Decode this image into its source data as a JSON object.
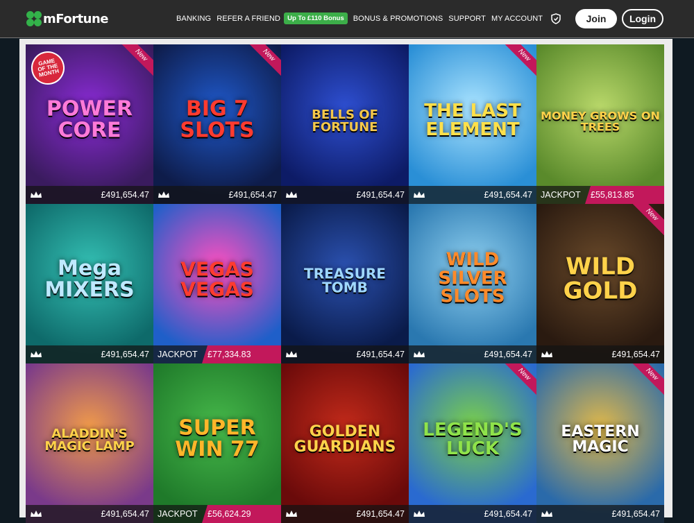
{
  "header": {
    "logo_text": "mFortune",
    "nav": [
      "BANKING",
      "REFER A FRIEND",
      "BONUS & PROMOTIONS",
      "SUPPORT",
      "MY ACCOUNT"
    ],
    "bonus_badge": "Up To £110 Bonus",
    "join_label": "Join",
    "login_label": "Login"
  },
  "labels": {
    "new": "New",
    "jackpot": "JACKPOT",
    "gotm": "GAME OF THE MONTH"
  },
  "colors": {
    "accent_pink": "#c2185b",
    "badge_green": "#3cae49",
    "topbar": "#2b2b2b"
  },
  "games": [
    {
      "name": "POWER CORE",
      "amount": "£491,654.47",
      "new": true,
      "gotm": true,
      "jackpot": false,
      "bg": "#3a1b5e",
      "bg2": "#8a2bd6",
      "fg": "#ff7ad9",
      "size": 30
    },
    {
      "name": "BIG 7 SLOTS",
      "amount": "£491,654.47",
      "new": true,
      "jackpot": false,
      "bg": "#0e1c4a",
      "bg2": "#1f58c9",
      "fg": "#ff3b2f",
      "size": 30
    },
    {
      "name": "BELLS OF FORTUNE",
      "amount": "£491,654.47",
      "new": false,
      "jackpot": false,
      "bg": "#0d1b66",
      "bg2": "#2e4fd1",
      "fg": "#f5c84a",
      "size": 18
    },
    {
      "name": "THE LAST ELEMENT",
      "amount": "£491,654.47",
      "new": true,
      "jackpot": false,
      "bg": "#2a8fd6",
      "bg2": "#a9e3ff",
      "fg": "#ffe04a",
      "size": 26
    },
    {
      "name": "MONEY GROWS ON TREES",
      "amount": "£55,813.85",
      "new": false,
      "jackpot": true,
      "bg": "#5a8a2b",
      "bg2": "#b9d86a",
      "fg": "#ffd24a",
      "size": 16
    },
    {
      "name": "Mega MIXERS",
      "amount": "£491,654.47",
      "new": false,
      "jackpot": false,
      "bg": "#0e6a6a",
      "bg2": "#34c0b4",
      "fg": "#bfe9ff",
      "size": 30
    },
    {
      "name": "VEGAS VEGAS",
      "amount": "£77,334.83",
      "new": false,
      "jackpot": true,
      "bg": "#1f5fc9",
      "bg2": "#ff4fbf",
      "fg": "#ff3b2f",
      "size": 28
    },
    {
      "name": "TREASURE TOMB",
      "amount": "£491,654.47",
      "new": false,
      "jackpot": false,
      "bg": "#0a1b4a",
      "bg2": "#2b51b0",
      "fg": "#9fd7ff",
      "size": 20
    },
    {
      "name": "WILD SILVER SLOTS",
      "amount": "£491,654.47",
      "new": false,
      "jackpot": false,
      "bg": "#2a78b0",
      "bg2": "#8fd0f0",
      "fg": "#ff8a2a",
      "size": 26
    },
    {
      "name": "WILD GOLD",
      "amount": "£491,654.47",
      "new": true,
      "jackpot": false,
      "bg": "#2a1a10",
      "bg2": "#6a4a2a",
      "fg": "#ffd24a",
      "size": 34
    },
    {
      "name": "ALADDIN'S MAGIC LAMP",
      "amount": "£491,654.47",
      "new": false,
      "jackpot": false,
      "bg": "#7a3a8a",
      "bg2": "#f09a4a",
      "fg": "#ffd24a",
      "size": 18
    },
    {
      "name": "SUPER WIN 77",
      "amount": "£56,624.29",
      "new": false,
      "jackpot": true,
      "bg": "#1f7a2a",
      "bg2": "#46b84a",
      "fg": "#ffb62a",
      "size": 30
    },
    {
      "name": "GOLDEN GUARDIANS",
      "amount": "£491,654.47",
      "new": false,
      "jackpot": false,
      "bg": "#6a0a0a",
      "bg2": "#c22a1a",
      "fg": "#ffd24a",
      "size": 22
    },
    {
      "name": "LEGEND'S LUCK",
      "amount": "£491,654.47",
      "new": true,
      "jackpot": false,
      "bg": "#2a6ad0",
      "bg2": "#7ad04a",
      "fg": "#8fe34a",
      "size": 26
    },
    {
      "name": "EASTERN MAGIC",
      "amount": "£491,654.47",
      "new": true,
      "jackpot": false,
      "bg": "#2a6aaa",
      "bg2": "#e0b84a",
      "fg": "#fff",
      "size": 22
    }
  ]
}
